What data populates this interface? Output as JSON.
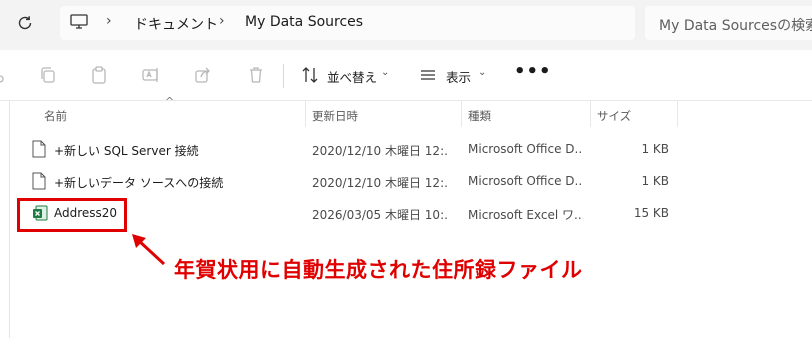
{
  "address_bar": {
    "breadcrumbs": [
      "ドキュメント",
      "My Data Sources"
    ],
    "search_placeholder": "My Data Sourcesの検索"
  },
  "toolbar": {
    "sort_label": "並べ替え",
    "view_label": "表示",
    "more_label": "•••"
  },
  "columns": {
    "name": "名前",
    "modified": "更新日時",
    "type": "種類",
    "size": "サイズ"
  },
  "files": [
    {
      "name": "+新しい SQL Server 接続",
      "modified": "2020/12/10 木曜日 12:...",
      "type": "Microsoft Office D...",
      "size": "1 KB",
      "icon": "document-icon"
    },
    {
      "name": "+新しいデータ ソースへの接続",
      "modified": "2020/12/10 木曜日 12:...",
      "type": "Microsoft Office D...",
      "size": "1 KB",
      "icon": "document-icon"
    },
    {
      "name": "Address20",
      "modified": "2026/03/05 木曜日 10:...",
      "type": "Microsoft Excel ワ...",
      "size": "15 KB",
      "icon": "excel-icon"
    }
  ],
  "annotation": {
    "text": "年賀状用に自動生成された住所録ファイル",
    "color": "#e00000"
  }
}
